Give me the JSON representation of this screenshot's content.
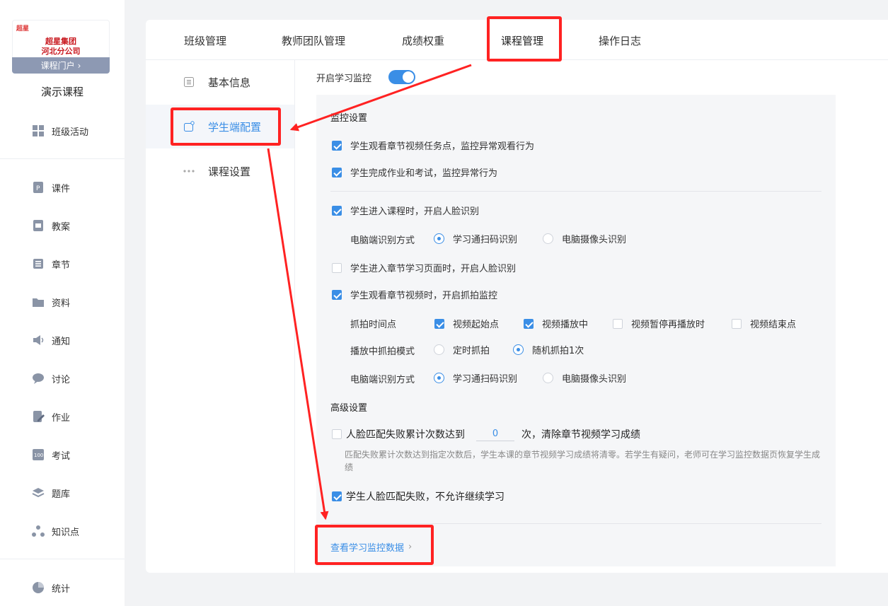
{
  "brand": {
    "logo_text": "超星",
    "line1": "超星集团",
    "line2": "河北分公司",
    "portal_label": "课程门户",
    "portal_chevron": "›"
  },
  "course_name": "演示课程",
  "sidebar": {
    "items": [
      {
        "label": "班级活动",
        "icon": "grid-icon"
      },
      {
        "label": "课件",
        "icon": "ppt-icon"
      },
      {
        "label": "教案",
        "icon": "lesson-plan-icon"
      },
      {
        "label": "章节",
        "icon": "list-icon"
      },
      {
        "label": "资料",
        "icon": "folder-icon"
      },
      {
        "label": "通知",
        "icon": "speaker-icon"
      },
      {
        "label": "讨论",
        "icon": "chat-icon"
      },
      {
        "label": "作业",
        "icon": "edit-icon"
      },
      {
        "label": "考试",
        "icon": "exam-icon"
      },
      {
        "label": "题库",
        "icon": "layers-icon"
      },
      {
        "label": "知识点",
        "icon": "nodes-icon"
      },
      {
        "label": "统计",
        "icon": "pie-icon"
      }
    ]
  },
  "tabs": [
    {
      "label": "班级管理"
    },
    {
      "label": "教师团队管理"
    },
    {
      "label": "成绩权重"
    },
    {
      "label": "课程管理",
      "active": true
    },
    {
      "label": "操作日志"
    }
  ],
  "left_nav": [
    {
      "label": "基本信息",
      "icon": "info-doc-icon"
    },
    {
      "label": "学生端配置",
      "icon": "student-config-icon",
      "active": true
    },
    {
      "label": "课程设置",
      "icon": "more-dots-icon"
    }
  ],
  "monitor": {
    "toggle_label": "开启学习监控",
    "toggle_on": true
  },
  "settings": {
    "monitor_title": "监控设置",
    "opt_video_task": {
      "label": "学生观看章节视频任务点，监控异常观看行为",
      "checked": true
    },
    "opt_homework_exam": {
      "label": "学生完成作业和考试，监控异常行为",
      "checked": true
    },
    "opt_face_course": {
      "label": "学生进入课程时，开启人脸识别",
      "checked": true
    },
    "pc_recog_label_1": "电脑端识别方式",
    "pc_recog_1": {
      "option_a": "学习通扫码识别",
      "option_b": "电脑摄像头识别",
      "selected": "option_a"
    },
    "opt_face_chapter": {
      "label": "学生进入章节学习页面时，开启人脸识别",
      "checked": false
    },
    "opt_snapshot": {
      "label": "学生观看章节视频时，开启抓拍监控",
      "checked": true
    },
    "snapshot_time_label": "抓拍时间点",
    "snapshot_times": [
      {
        "label": "视频起始点",
        "checked": true
      },
      {
        "label": "视频播放中",
        "checked": true
      },
      {
        "label": "视频暂停再播放时",
        "checked": false
      },
      {
        "label": "视频结束点",
        "checked": false
      }
    ],
    "snapshot_mode_label": "播放中抓拍模式",
    "snapshot_mode": {
      "option_a": "定时抓拍",
      "option_b": "随机抓拍1次",
      "selected": "option_b"
    },
    "pc_recog_label_2": "电脑端识别方式",
    "pc_recog_2": {
      "option_a": "学习通扫码识别",
      "option_b": "电脑摄像头识别",
      "selected": "option_a"
    },
    "advanced_title": "高级设置",
    "fail_count": {
      "prefix": "人脸匹配失败累计次数达到",
      "value": "0",
      "suffix": "次，清除章节视频学习成绩",
      "checked": false
    },
    "fail_hint": "匹配失败累计次数达到指定次数后，学生本课的章节视频学习成绩将清零。若学生有疑问，老师可在学习监控数据页恢复学生成绩",
    "fail_block": {
      "label": "学生人脸匹配失败，不允许继续学习",
      "checked": true
    },
    "view_link": "查看学习监控数据",
    "view_link_chevron": "›"
  },
  "annotation_color": "#ff2222",
  "accent_color": "#3a8ee6"
}
